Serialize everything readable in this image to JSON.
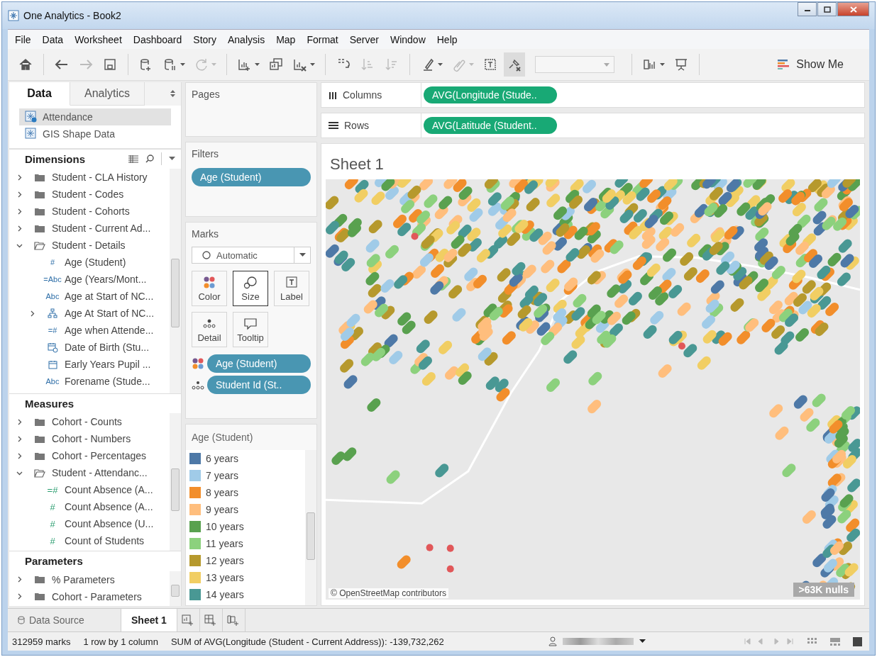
{
  "window": {
    "title": "One Analytics - Book2"
  },
  "menu": [
    "File",
    "Data",
    "Worksheet",
    "Dashboard",
    "Story",
    "Analysis",
    "Map",
    "Format",
    "Server",
    "Window",
    "Help"
  ],
  "toolbar_groups": [
    [
      {
        "kind": "home",
        "disabled": false,
        "menu": false
      }
    ],
    [
      {
        "kind": "back",
        "disabled": false,
        "menu": false
      },
      {
        "kind": "forward",
        "disabled": true,
        "menu": false
      },
      {
        "kind": "save",
        "disabled": false,
        "menu": false
      }
    ],
    [
      {
        "kind": "add-data",
        "disabled": false,
        "menu": false
      },
      {
        "kind": "pause",
        "disabled": false,
        "menu": true
      },
      {
        "kind": "refresh",
        "disabled": true,
        "menu": true
      }
    ],
    [
      {
        "kind": "new-sheet",
        "disabled": false,
        "menu": true
      },
      {
        "kind": "duplicate",
        "disabled": false,
        "menu": false
      },
      {
        "kind": "clear",
        "disabled": false,
        "menu": true
      }
    ],
    [
      {
        "kind": "swap",
        "disabled": false,
        "menu": false
      },
      {
        "kind": "sort-asc",
        "disabled": true,
        "menu": false
      },
      {
        "kind": "sort-desc",
        "disabled": true,
        "menu": false
      }
    ],
    [
      {
        "kind": "highlight",
        "disabled": false,
        "menu": true
      },
      {
        "kind": "clip",
        "disabled": true,
        "menu": true
      },
      {
        "kind": "labels",
        "disabled": false,
        "menu": false
      },
      {
        "kind": "pin",
        "disabled": false,
        "menu": false,
        "pressed": true
      },
      {
        "kind": "fit",
        "disabled": true,
        "menu": true
      }
    ],
    [
      {
        "kind": "cards",
        "disabled": false,
        "menu": true
      },
      {
        "kind": "present",
        "disabled": false,
        "menu": false
      }
    ]
  ],
  "show_me": "Show Me",
  "side_tabs": [
    {
      "label": "Data",
      "selected": true
    },
    {
      "label": "Analytics",
      "selected": false
    }
  ],
  "data_sources": [
    {
      "label": "Attendance",
      "selected": true
    },
    {
      "label": "GIS Shape Data",
      "selected": false
    }
  ],
  "dimensions": {
    "title": "Dimensions",
    "items": [
      {
        "kind": "folder",
        "label": "Student - CLA History",
        "expanded": false
      },
      {
        "kind": "folder",
        "label": "Student - Codes",
        "expanded": false
      },
      {
        "kind": "folder",
        "label": "Student - Cohorts",
        "expanded": false
      },
      {
        "kind": "folder",
        "label": "Student - Current Ad...",
        "expanded": false
      },
      {
        "kind": "folder",
        "label": "Student - Details",
        "expanded": true,
        "children": [
          {
            "kind": "field",
            "glyph": "#",
            "label": "Age (Student)"
          },
          {
            "kind": "field",
            "glyph": "=Abc",
            "label": "Age (Years/Mont..."
          },
          {
            "kind": "field",
            "glyph": "Abc",
            "label": "Age at Start of NC..."
          },
          {
            "kind": "hierarchy",
            "label": "Age At Start of NC...",
            "expanded": false
          },
          {
            "kind": "field",
            "glyph": "=#",
            "label": "Age when Attende..."
          },
          {
            "kind": "datetime",
            "label": "Date of Birth (Stu..."
          },
          {
            "kind": "date",
            "label": "Early Years Pupil ..."
          },
          {
            "kind": "field",
            "glyph": "Abc",
            "label": "Forename (Stude..."
          }
        ]
      }
    ]
  },
  "measures": {
    "title": "Measures",
    "items": [
      {
        "kind": "folder",
        "label": "Cohort - Counts",
        "expanded": false
      },
      {
        "kind": "folder",
        "label": "Cohort - Numbers",
        "expanded": false
      },
      {
        "kind": "folder",
        "label": "Cohort - Percentages",
        "expanded": false
      },
      {
        "kind": "folder",
        "label": "Student - Attendanc...",
        "expanded": true,
        "children": [
          {
            "kind": "field",
            "glyph": "=#",
            "label": "Count Absence (A..."
          },
          {
            "kind": "field",
            "glyph": "#",
            "label": "Count Absence (A..."
          },
          {
            "kind": "field",
            "glyph": "#",
            "label": "Count Absence (U..."
          },
          {
            "kind": "field",
            "glyph": "#",
            "label": "Count of Students"
          }
        ]
      }
    ]
  },
  "parameters": {
    "title": "Parameters",
    "items": [
      {
        "kind": "folder",
        "label": "% Parameters",
        "expanded": false
      },
      {
        "kind": "folder",
        "label": "Cohort - Parameters",
        "expanded": false
      }
    ]
  },
  "pages": {
    "title": "Pages"
  },
  "filters": {
    "title": "Filters",
    "pills": [
      "Age (Student)"
    ]
  },
  "marks": {
    "title": "Marks",
    "mark_type": "Automatic",
    "cards": [
      {
        "kind": "color",
        "label": "Color",
        "selected": false
      },
      {
        "kind": "size",
        "label": "Size",
        "selected": true
      },
      {
        "kind": "label",
        "label": "Label",
        "selected": false
      },
      {
        "kind": "detail",
        "label": "Detail",
        "selected": false
      },
      {
        "kind": "tooltip",
        "label": "Tooltip",
        "selected": false
      }
    ],
    "pills": [
      {
        "kind": "color",
        "label": "Age (Student)"
      },
      {
        "kind": "detail",
        "label": "Student Id (St.."
      }
    ]
  },
  "legend": {
    "title": "Age (Student)",
    "items": [
      {
        "label": "6 years",
        "color": "#4e79a7"
      },
      {
        "label": "7 years",
        "color": "#a0cbe8"
      },
      {
        "label": "8 years",
        "color": "#f28e2b"
      },
      {
        "label": "9 years",
        "color": "#ffbe7d"
      },
      {
        "label": "10 years",
        "color": "#59a14f"
      },
      {
        "label": "11 years",
        "color": "#8cd17d"
      },
      {
        "label": "12 years",
        "color": "#b6992d"
      },
      {
        "label": "13 years",
        "color": "#f1ce63"
      },
      {
        "label": "14 years",
        "color": "#499894"
      }
    ]
  },
  "shelves": [
    {
      "label": "Columns",
      "kind": "columns",
      "pill": "AVG(Longitude (Stude.."
    },
    {
      "label": "Rows",
      "kind": "rows",
      "pill": "AVG(Latitude (Student.."
    }
  ],
  "sheet": {
    "title": "Sheet 1",
    "attribution": "© OpenStreetMap contributors",
    "nulls": ">63K nulls"
  },
  "bottom_tabs": [
    {
      "label": "Data Source",
      "kind": "datasource",
      "selected": false
    },
    {
      "label": "Sheet 1",
      "kind": "sheet",
      "selected": true
    }
  ],
  "status_bar": {
    "marks": "312959 marks",
    "dims": "1 row by 1 column",
    "summary": "SUM of AVG(Longitude (Student - Current Address)): -139,732,262"
  }
}
